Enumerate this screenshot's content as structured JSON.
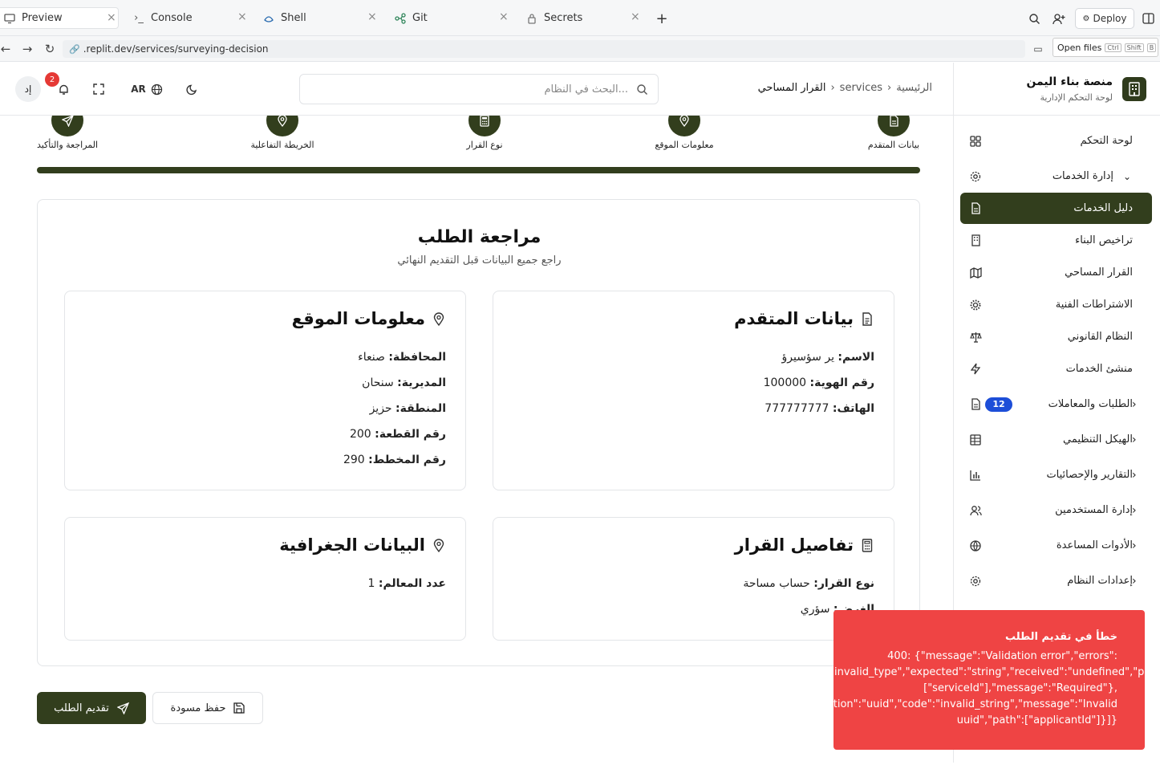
{
  "tabs": [
    {
      "label": "Preview",
      "active": true,
      "icon": "monitor-icon"
    },
    {
      "label": "Console",
      "icon": "terminal-icon"
    },
    {
      "label": "Shell",
      "icon": "shell-icon"
    },
    {
      "label": "Git",
      "icon": "git-icon"
    },
    {
      "label": "Secrets",
      "icon": "lock-icon"
    }
  ],
  "topbar": {
    "deploy_label": "Deploy"
  },
  "urlbar": {
    "url": ".replit.dev/services/surveying-decision",
    "open_files": "Open files",
    "kbd": [
      "Ctrl",
      "Shift",
      "B"
    ]
  },
  "brand": {
    "title": "منصة بناء اليمن",
    "subtitle": "لوحة التحكم الإدارية"
  },
  "sidebar": {
    "items": [
      {
        "label": "لوحة التحكم",
        "icon": "grid-icon"
      },
      {
        "label": "إدارة الخدمات",
        "icon": "gear-icon",
        "chevron": "down"
      },
      {
        "label": "دليل الخدمات",
        "icon": "document-icon",
        "active": true
      },
      {
        "label": "تراخيص البناء",
        "icon": "building-icon"
      },
      {
        "label": "القرار المساحي",
        "icon": "map-icon"
      },
      {
        "label": "الاشتراطات الفنية",
        "icon": "cog-icon"
      },
      {
        "label": "النظام القانوني",
        "icon": "scale-icon"
      },
      {
        "label": "منشئ الخدمات",
        "icon": "bolt-icon"
      },
      {
        "label": "الطلبات والمعاملات",
        "icon": "file-icon",
        "badge": "12",
        "chevron": "right"
      },
      {
        "label": "الهيكل التنظيمي",
        "icon": "table-icon",
        "chevron": "right"
      },
      {
        "label": "التقارير والإحصائيات",
        "icon": "chart-icon",
        "chevron": "right"
      },
      {
        "label": "إدارة المستخدمين",
        "icon": "users-icon",
        "chevron": "right"
      },
      {
        "label": "الأدوات المساعدة",
        "icon": "globe-icon",
        "chevron": "right"
      },
      {
        "label": "إعدادات النظام",
        "icon": "settings-icon",
        "chevron": "right"
      }
    ]
  },
  "header": {
    "breadcrumbs": [
      "الرئيسية",
      "services",
      "القرار المساحي"
    ],
    "search_placeholder": "البحث في النظام...",
    "lang": "AR",
    "avatar": "إد",
    "notifications": "2"
  },
  "steps": [
    {
      "label": "بيانات المتقدم",
      "icon": "document-icon"
    },
    {
      "label": "معلومات الموقع",
      "icon": "pin-icon"
    },
    {
      "label": "نوع القرار",
      "icon": "calculator-icon"
    },
    {
      "label": "الخريطة التفاعلية",
      "icon": "pin-icon"
    },
    {
      "label": "المراجعة والتأكيد",
      "icon": "send-icon"
    }
  ],
  "review": {
    "title": "مراجعة الطلب",
    "subtitle": "راجع جميع البيانات قبل التقديم النهائي",
    "applicant": {
      "title": "بيانات المتقدم",
      "rows": [
        {
          "label": "الاسم:",
          "value": "ير سؤسيرؤ"
        },
        {
          "label": "رقم الهوية:",
          "value": "100000"
        },
        {
          "label": "الهاتف:",
          "value": "777777777"
        }
      ]
    },
    "location": {
      "title": "معلومات الموقع",
      "rows": [
        {
          "label": "المحافظة:",
          "value": "صنعاء"
        },
        {
          "label": "المديرية:",
          "value": "سنحان"
        },
        {
          "label": "المنطقة:",
          "value": "حزيز"
        },
        {
          "label": "رقم القطعة:",
          "value": "200"
        },
        {
          "label": "رقم المخطط:",
          "value": "290"
        }
      ]
    },
    "decision": {
      "title": "تفاصيل القرار",
      "rows": [
        {
          "label": "نوع القرار:",
          "value": "حساب مساحة"
        },
        {
          "label": "الغرض:",
          "value": "سؤري"
        }
      ]
    },
    "geo": {
      "title": "البيانات الجغرافية",
      "rows": [
        {
          "label": "عدد المعالم:",
          "value": "1"
        }
      ]
    }
  },
  "actions": {
    "submit": "تقديم الطلب",
    "draft": "حفظ مسودة"
  },
  "toast": {
    "title": "خطأ في تقديم الطلب",
    "lines": [
      "400: {\"message\":\"Validation error\",\"errors\":",
      "[{\"code\":\"invalid_type\",\"expected\":\"string\",\"received\":\"undefined\",\"path\":",
      "[\"serviceId\"],\"message\":\"Required\"},",
      "{\"validation\":\"uuid\",\"code\":\"invalid_string\",\"message\":\"Invalid",
      "uuid\",\"path\":[\"applicantId\"]}]}"
    ]
  }
}
